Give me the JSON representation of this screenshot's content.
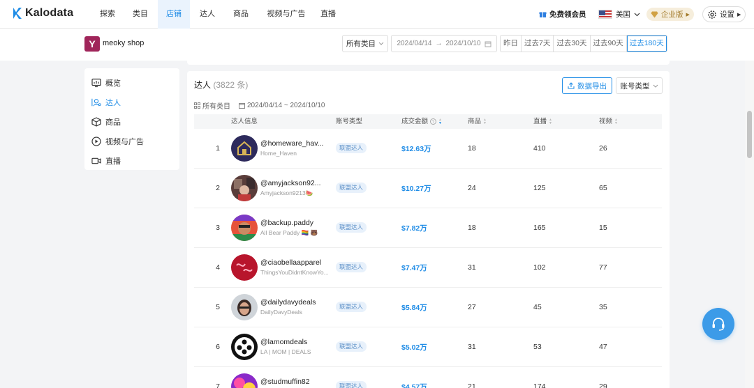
{
  "app": {
    "name": "Kalodata"
  },
  "nav": {
    "items": [
      {
        "label": "探索"
      },
      {
        "label": "类目"
      },
      {
        "label": "店铺"
      },
      {
        "label": "达人"
      },
      {
        "label": "商品"
      },
      {
        "label": "视频与广告"
      },
      {
        "label": "直播"
      }
    ],
    "active_index": 2,
    "vip_label": "免费领会员",
    "lang_label": "美国",
    "enterprise_label": "企业版",
    "settings_label": "设置"
  },
  "shop": {
    "logo_letter": "Y",
    "name": "meoky shop",
    "category_select": "所有类目",
    "date_start": "2024/04/14",
    "date_arrow": "→",
    "date_end": "2024/10/10",
    "quick_ranges": [
      "昨日",
      "过去7天",
      "过去30天",
      "过去90天",
      "过去180天"
    ],
    "active_range_index": 4
  },
  "sidebar": {
    "items": [
      {
        "label": "概览",
        "icon": "overview-icon"
      },
      {
        "label": "达人",
        "icon": "creator-icon"
      },
      {
        "label": "商品",
        "icon": "box-icon"
      },
      {
        "label": "视频与广告",
        "icon": "play-icon"
      },
      {
        "label": "直播",
        "icon": "video-camera-icon"
      }
    ],
    "active_index": 1
  },
  "panel": {
    "title": "达人",
    "count": "(3822 条)",
    "export_label": "数据导出",
    "type_select": "账号类型",
    "filter_category": "所有类目",
    "filter_dates": "2024/04/14 ~ 2024/10/10"
  },
  "table": {
    "headers": {
      "creator": "达人信息",
      "account_type": "账号类型",
      "gmv": "成交金额",
      "products": "商品",
      "live": "直播",
      "videos": "视频"
    },
    "rows": [
      {
        "rank": "1",
        "handle": "@homeware_hav...",
        "nick": "Home_Haven",
        "type": "联盟达人",
        "gmv": "$12.63万",
        "products": "18",
        "live": "410",
        "videos": "26"
      },
      {
        "rank": "2",
        "handle": "@amyjackson92...",
        "nick": "Amyjackson9213🍉",
        "type": "联盟达人",
        "gmv": "$10.27万",
        "products": "24",
        "live": "125",
        "videos": "65"
      },
      {
        "rank": "3",
        "handle": "@backup.paddy",
        "nick": "All Bear Paddy 🏳️‍🌈 🐻",
        "type": "联盟达人",
        "gmv": "$7.82万",
        "products": "18",
        "live": "165",
        "videos": "15"
      },
      {
        "rank": "4",
        "handle": "@ciaobellaapparel",
        "nick": "ThingsYouDidntKnowYo...",
        "type": "联盟达人",
        "gmv": "$7.47万",
        "products": "31",
        "live": "102",
        "videos": "77"
      },
      {
        "rank": "5",
        "handle": "@dailydavydeals",
        "nick": "DailyDavyDeals",
        "type": "联盟达人",
        "gmv": "$5.84万",
        "products": "27",
        "live": "45",
        "videos": "35"
      },
      {
        "rank": "6",
        "handle": "@lamomdeals",
        "nick": "LA | MOM | DEALS",
        "type": "联盟达人",
        "gmv": "$5.02万",
        "products": "31",
        "live": "53",
        "videos": "47"
      },
      {
        "rank": "7",
        "handle": "@studmuffin82",
        "nick": "",
        "type": "联盟达人",
        "gmv": "$4.57万",
        "products": "21",
        "live": "174",
        "videos": "29"
      }
    ]
  },
  "colors": {
    "accent": "#1f8ce6",
    "brand_shop": "#a0255a",
    "fab": "#3c9be8"
  }
}
